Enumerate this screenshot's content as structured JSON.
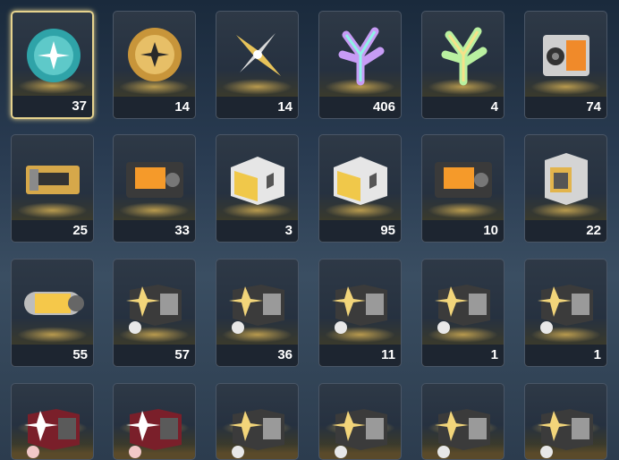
{
  "inventory": {
    "items": [
      {
        "icon": "teal-orb-icon",
        "count": "37",
        "selected": true
      },
      {
        "icon": "gold-orb-icon",
        "count": "14"
      },
      {
        "icon": "gold-shuriken-icon",
        "count": "14"
      },
      {
        "icon": "holo-coral-pink-icon",
        "count": "406"
      },
      {
        "icon": "holo-coral-green-icon",
        "count": "4"
      },
      {
        "icon": "orange-cube-device-icon",
        "count": "74"
      },
      {
        "icon": "gold-crate-small-icon",
        "count": "25"
      },
      {
        "icon": "orange-crate-icon",
        "count": "33"
      },
      {
        "icon": "silver-gold-crate-icon",
        "count": "3"
      },
      {
        "icon": "silver-gold-crate-icon",
        "count": "95"
      },
      {
        "icon": "orange-crate-icon",
        "count": "10"
      },
      {
        "icon": "silver-cube-icon",
        "count": "22"
      },
      {
        "icon": "yellow-capsule-icon",
        "count": "55"
      },
      {
        "icon": "star-lock-crate-icon",
        "count": "57"
      },
      {
        "icon": "star-lock-crate-icon",
        "count": "36"
      },
      {
        "icon": "star-lock-crate-icon",
        "count": "11"
      },
      {
        "icon": "star-lock-crate-icon",
        "count": "1"
      },
      {
        "icon": "star-lock-crate-icon",
        "count": "1"
      },
      {
        "icon": "red-star-crate-icon",
        "count": ""
      },
      {
        "icon": "red-star-crate-icon",
        "count": ""
      },
      {
        "icon": "star-lock-crate-icon",
        "count": ""
      },
      {
        "icon": "star-lock-crate-icon",
        "count": ""
      },
      {
        "icon": "star-lock-crate-icon",
        "count": ""
      },
      {
        "icon": "star-lock-crate-icon",
        "count": ""
      }
    ]
  }
}
